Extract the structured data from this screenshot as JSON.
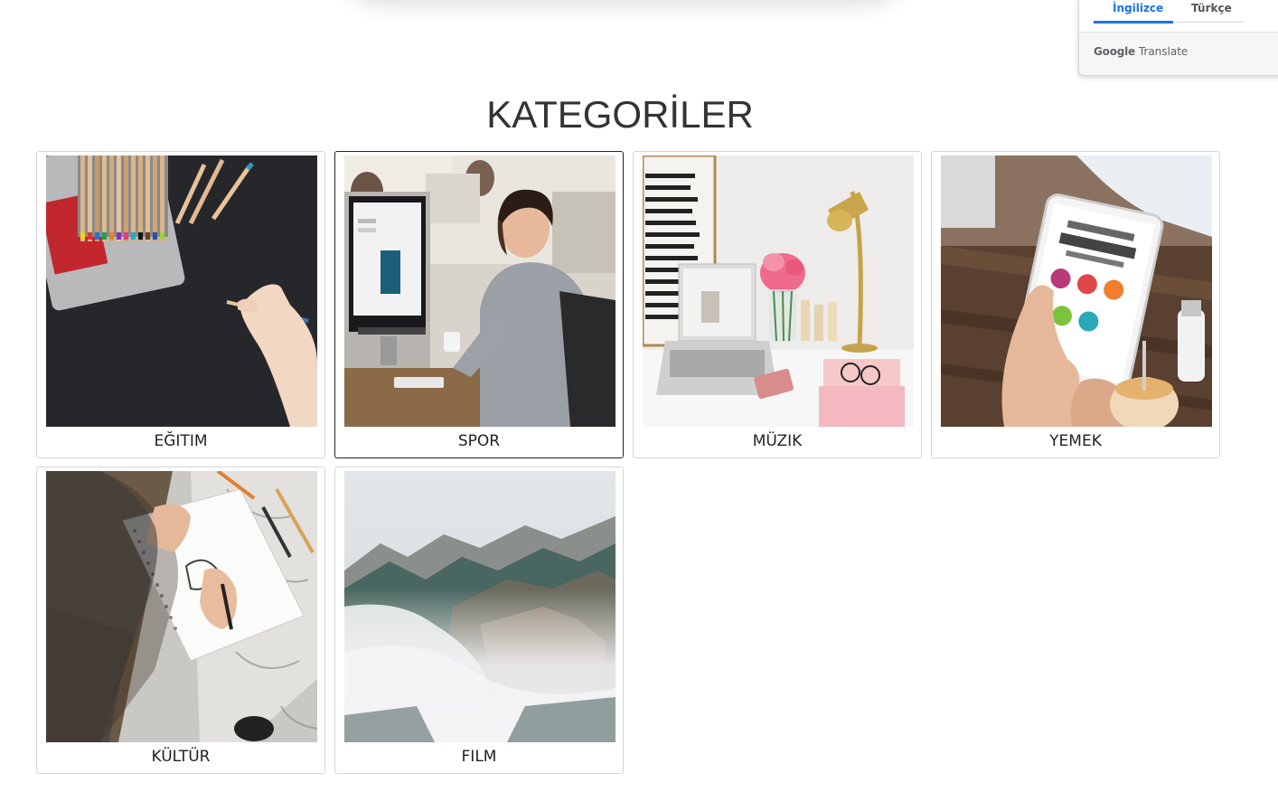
{
  "translate_widget": {
    "tabs": [
      {
        "label": "İngilizce",
        "active": true
      },
      {
        "label": "Türkçe",
        "active": false
      }
    ],
    "brand": "Google",
    "product": "Translate"
  },
  "heading": "KATEGORİLER",
  "categories": [
    {
      "label": "EĞITIM",
      "image": "drawing-hand-with-pencils"
    },
    {
      "label": "SPOR",
      "image": "man-at-computer-office"
    },
    {
      "label": "MÜZIK",
      "image": "white-desk-with-laptop-lamp-flowers"
    },
    {
      "label": "YEMEK",
      "image": "tablet-marketing-strategy"
    },
    {
      "label": "KÜLTÜR",
      "image": "person-sketching-notebook"
    },
    {
      "label": "FILM",
      "image": "misty-mountain"
    }
  ],
  "colors": {
    "accent": "#1a73e8",
    "heading": "#333333",
    "card_border": "#d6d6d6"
  }
}
